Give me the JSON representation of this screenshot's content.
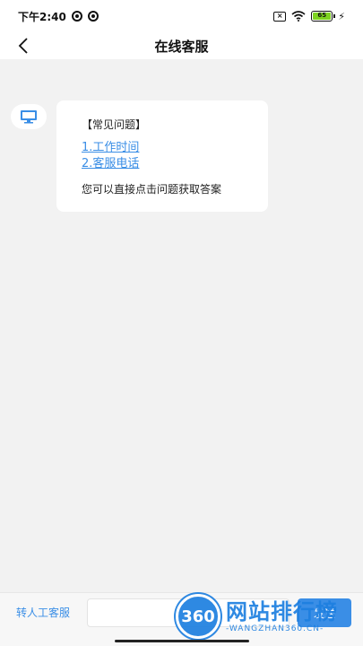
{
  "status_bar": {
    "time": "下午2:40",
    "battery": "65"
  },
  "header": {
    "title": "在线客服"
  },
  "chat": {
    "avatar_icon": "monitor-icon",
    "heading": "【常见问题】",
    "links": [
      "1.工作时间",
      "2.客服电话"
    ],
    "hint": "您可以直接点击问题获取答案"
  },
  "bottom": {
    "transfer_label": "转人工客服",
    "input_placeholder": "",
    "send_label": "发送"
  },
  "watermark": {
    "logo_text": "360",
    "brand": "网站排行榜",
    "url": "-WANGZHAN360.CN-"
  },
  "colors": {
    "accent": "#3a8ee6",
    "background": "#f2f2f2",
    "battery": "#7ed321"
  }
}
